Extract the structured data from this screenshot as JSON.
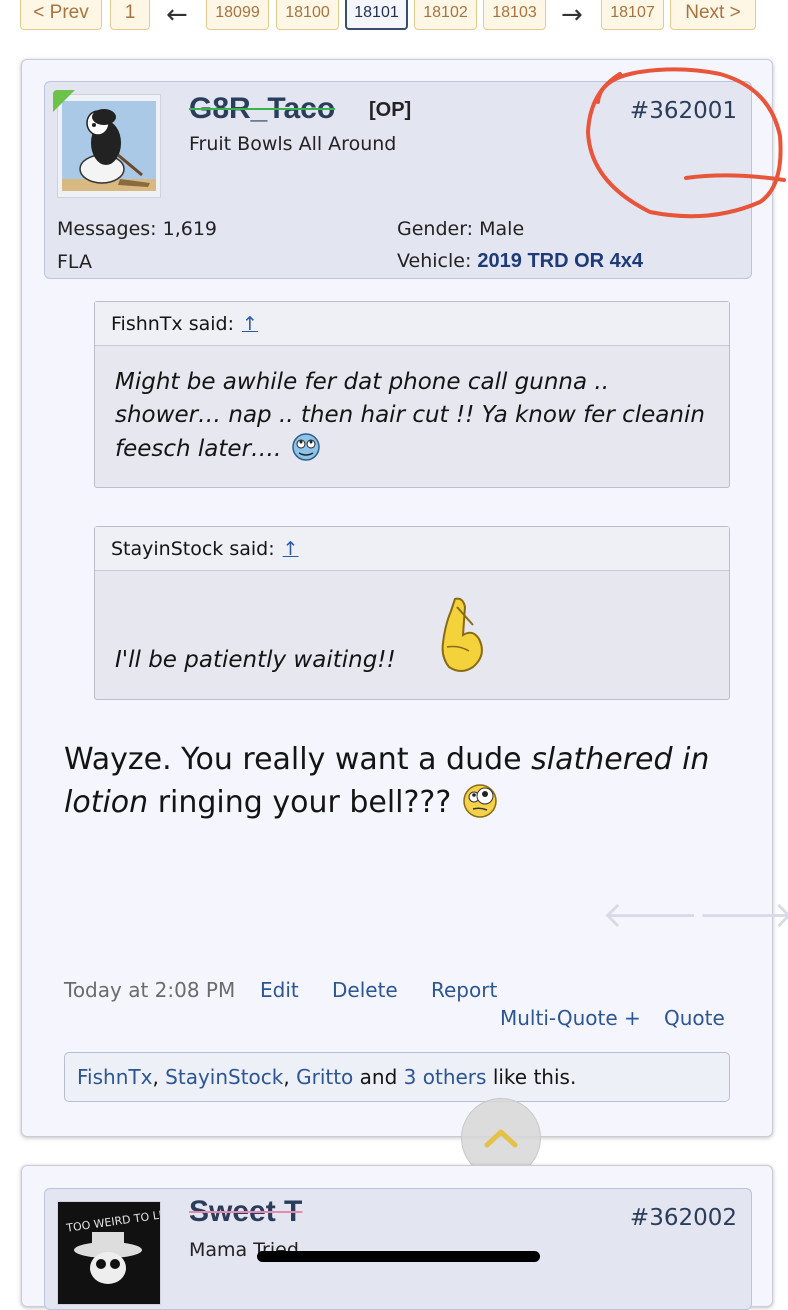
{
  "pagination": {
    "prev": "< Prev",
    "first": "1",
    "left_arrow": "←",
    "pages": [
      "18099",
      "18100",
      "18101",
      "18102",
      "18103"
    ],
    "right_arrow": "→",
    "last": "18107",
    "next": "Next >"
  },
  "post1": {
    "username": "G8R_Taco",
    "op_badge": "[OP]",
    "user_title": "Fruit Bowls All Around",
    "post_number": "#362001",
    "messages_label": "Messages:",
    "messages_value": "1,619",
    "location": "FLA",
    "gender_label": "Gender:",
    "gender_value": "Male",
    "vehicle_label": "Vehicle:",
    "vehicle_value": "2019 TRD OR 4x4",
    "quotes": [
      {
        "author": "FishnTx said:",
        "up": "↑",
        "text": "Might be awhile fer dat phone call gunna .. shower… nap .. then hair cut !! Ya know fer cleanin feesch later…."
      },
      {
        "author": "StayinStock said:",
        "up": "↑",
        "text": "I'll be patiently waiting!!"
      }
    ],
    "message": {
      "part1": "Wayze. You really want a dude ",
      "emph": "slathered in lotion",
      "part2": " ringing your bell???"
    },
    "timestamp": "Today at 2:08 PM",
    "edit": "Edit",
    "delete": "Delete",
    "report": "Report",
    "multiquote": "Multi-Quote +",
    "quote": "Quote",
    "likes": {
      "users": [
        "FishnTx",
        "StayinStock",
        "Gritto"
      ],
      "and": "and",
      "others": "3 others",
      "suffix": "like this."
    }
  },
  "post2": {
    "username": "Sweet T",
    "user_title": "Mama Tried",
    "post_number": "#362002",
    "avatar_text": "TOO WEIRD TO LIVE"
  },
  "colors": {
    "username": "#2a3d5a",
    "link": "#2c5594",
    "annotation": "#e8553a",
    "online_badge": "#6cc24a"
  }
}
